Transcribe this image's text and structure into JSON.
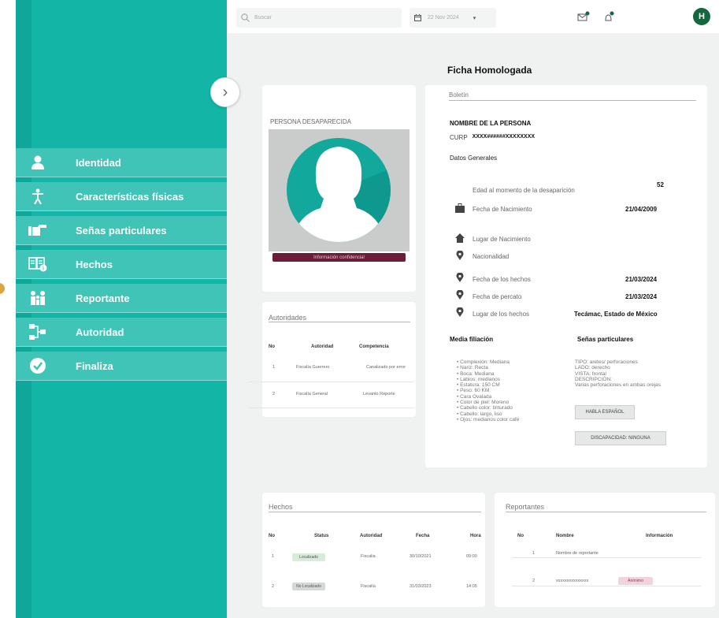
{
  "sidebar": {
    "items": [
      {
        "label": "Identidad",
        "icon": "user-icon"
      },
      {
        "label": "Características físicas",
        "icon": "person-figure-icon"
      },
      {
        "label": "Señas particulares",
        "icon": "pointing-hand-icon"
      },
      {
        "label": "Hechos",
        "icon": "open-book-icon"
      },
      {
        "label": "Reportante",
        "icon": "family-icon"
      },
      {
        "label": "Autoridad",
        "icon": "hierarchy-icon"
      },
      {
        "label": "Finaliza",
        "icon": "check-circle-icon"
      }
    ]
  },
  "topbar": {
    "search_placeholder": "Buscar",
    "date_value": "22 Nov 2024",
    "avatar_initial": "H"
  },
  "page": {
    "title": "Ficha Homologada"
  },
  "photo_card": {
    "heading": "PERSONA DESAPARECIDA",
    "banner": "Información confidencial"
  },
  "boletin": {
    "title": "Boletín",
    "name_heading": "NOMBRE DE LA PERSONA",
    "curp_label": "CURP",
    "curp_value": "XXXX######XXXXXXXX",
    "general_heading": "Datos Generales",
    "rows": [
      {
        "label": "Edad al momento de la desaparición",
        "value": "52"
      },
      {
        "label": "Fecha de Nacimiento",
        "value": "21/04/2009"
      },
      {
        "label": "Lugar de Nacimiento",
        "value": ""
      },
      {
        "label": "Nacionalidad",
        "value": ""
      },
      {
        "label": "Fecha de los hechos",
        "value": "21/03/2024"
      },
      {
        "label": "Fecha de percato",
        "value": "21/03/2024"
      },
      {
        "label": "Lugar de los hechos",
        "value": "Tecámac, Estado de México"
      }
    ],
    "media_filiacion": {
      "heading": "Media filiación",
      "items": [
        "Complexión: Mediana",
        "Nariz: Recta",
        "Boca: Mediana",
        "Labios: medianos",
        "Estatura: 150 CM",
        "Peso: 60 KM",
        "Cara Ovalada",
        "Color de piel: Moreno",
        "Cabello color: tinturado",
        "Cabello: largo, liso",
        "Ojos: medianos color café"
      ]
    },
    "senas": {
      "heading": "Señas particulares",
      "lines": [
        "TIPO: aretes/ perforaciones",
        "LADO: derecho",
        "VISTA: frontal",
        "DESCRIPCIÓN:",
        "Varias perforaciones en ambas orejas"
      ],
      "tag1": "HABLA ESPAÑOL",
      "tag2": "DISCAPACIDAD: NINGUNA"
    }
  },
  "autoridades": {
    "title": "Autoridades",
    "headers": [
      "No",
      "Autoridad",
      "Competencia"
    ],
    "rows": [
      {
        "no": "1",
        "autoridad": "Fiscalía Guerrero",
        "competencia": "Canalizado por error"
      },
      {
        "no": "2",
        "autoridad": "Fiscalía General",
        "competencia": "Levanto Reporte"
      }
    ]
  },
  "hechos": {
    "title": "Hechos",
    "headers": [
      "No",
      "Status",
      "Autoridad",
      "Fecha",
      "Hora"
    ],
    "rows": [
      {
        "no": "1",
        "status": "Localizado",
        "autoridad": "Fiscalia",
        "fecha": "30/10/2021",
        "hora": "09:00"
      },
      {
        "no": "2",
        "status": "No Localizado",
        "autoridad": "Fiscalía",
        "fecha": "31/03/2023",
        "hora": "14:05"
      }
    ]
  },
  "reportantes": {
    "title": "Reportantes",
    "headers": [
      "No",
      "Nombre",
      "Información"
    ],
    "rows": [
      {
        "no": "1",
        "nombre": "Nombre de reportante",
        "info": ""
      },
      {
        "no": "2",
        "nombre": "xxxxxxxxxxxxxxx",
        "info": "Anónimo"
      }
    ]
  },
  "colors": {
    "teal": "#12b5a6",
    "teal_light": "#3fc4b7",
    "banner": "#6b1c38",
    "avatar": "#14683f"
  }
}
